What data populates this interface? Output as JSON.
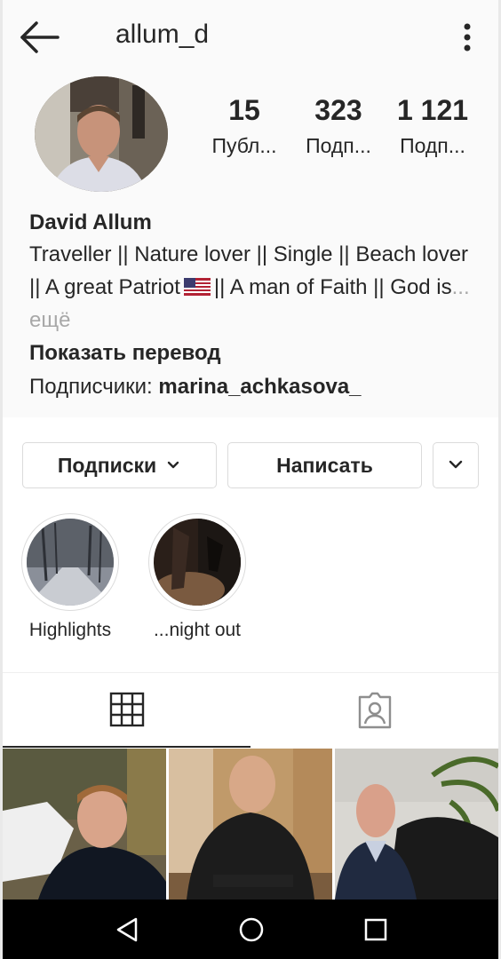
{
  "header": {
    "username": "allum_d",
    "back_icon": "arrow-left-icon",
    "more_icon": "more-vertical-icon"
  },
  "profile": {
    "stats": [
      {
        "value": "15",
        "label": "Публ..."
      },
      {
        "value": "323",
        "label": "Подп..."
      },
      {
        "value": "1 121",
        "label": "Подп..."
      }
    ],
    "full_name": "David Allum",
    "bio_part1": "Traveller || Nature lover || Single || Beach lover || A great Patriot",
    "bio_part2": "|| A man of Faith || God is",
    "bio_more": "... ещё",
    "show_translation": "Показать перевод",
    "followed_by_label": "Подписчики:",
    "followed_by_user": "marina_achkasova_"
  },
  "actions": {
    "following": "Подписки",
    "message": "Написать"
  },
  "highlights": [
    {
      "label": "Highlights"
    },
    {
      "label": "...night out"
    }
  ],
  "tabs": {
    "grid_icon": "grid-icon",
    "tagged_icon": "tagged-person-icon"
  },
  "system_nav": {
    "back_icon": "triangle-back-icon",
    "home_icon": "circle-home-icon",
    "recent_icon": "square-recents-icon"
  }
}
